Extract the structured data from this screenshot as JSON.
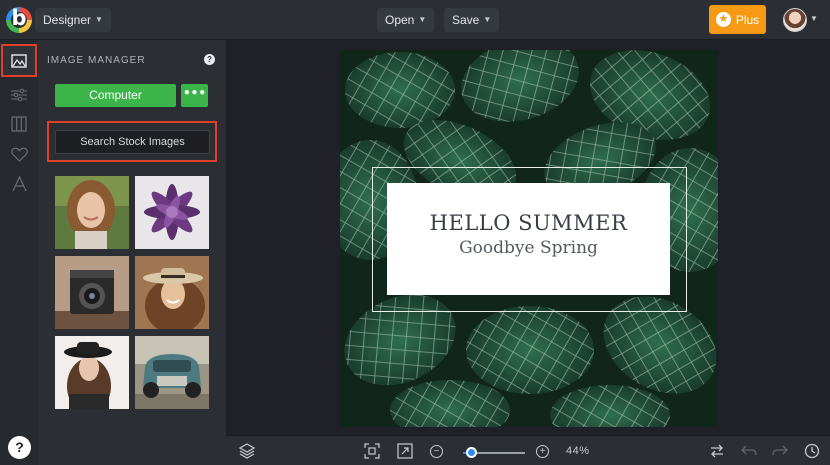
{
  "topbar": {
    "logo_letter": "b",
    "mode_label": "Designer",
    "open_label": "Open",
    "save_label": "Save",
    "plus_label": "Plus"
  },
  "rail": {
    "items": [
      "image-manager",
      "adjustments",
      "layout",
      "favorites",
      "text"
    ]
  },
  "panel": {
    "title": "IMAGE MANAGER",
    "help_glyph": "?",
    "computer_label": "Computer",
    "more_label": "•••",
    "search_label": "Search Stock Images",
    "thumbnails": [
      "woman-portrait",
      "purple-succulent",
      "vintage-camera",
      "woman-with-hat",
      "woman-in-black-hat",
      "vintage-car"
    ]
  },
  "canvas": {
    "title": "HELLO SUMMER",
    "subtitle": "Goodbye Spring"
  },
  "bottombar": {
    "zoom_label": "44%",
    "zoom_value": 0.44
  },
  "help_glyph": "?",
  "colors": {
    "accent_green": "#3bb54a",
    "accent_orange": "#f59a12",
    "highlight_red": "#e0402a",
    "zoom_blue": "#2d8cf0"
  }
}
